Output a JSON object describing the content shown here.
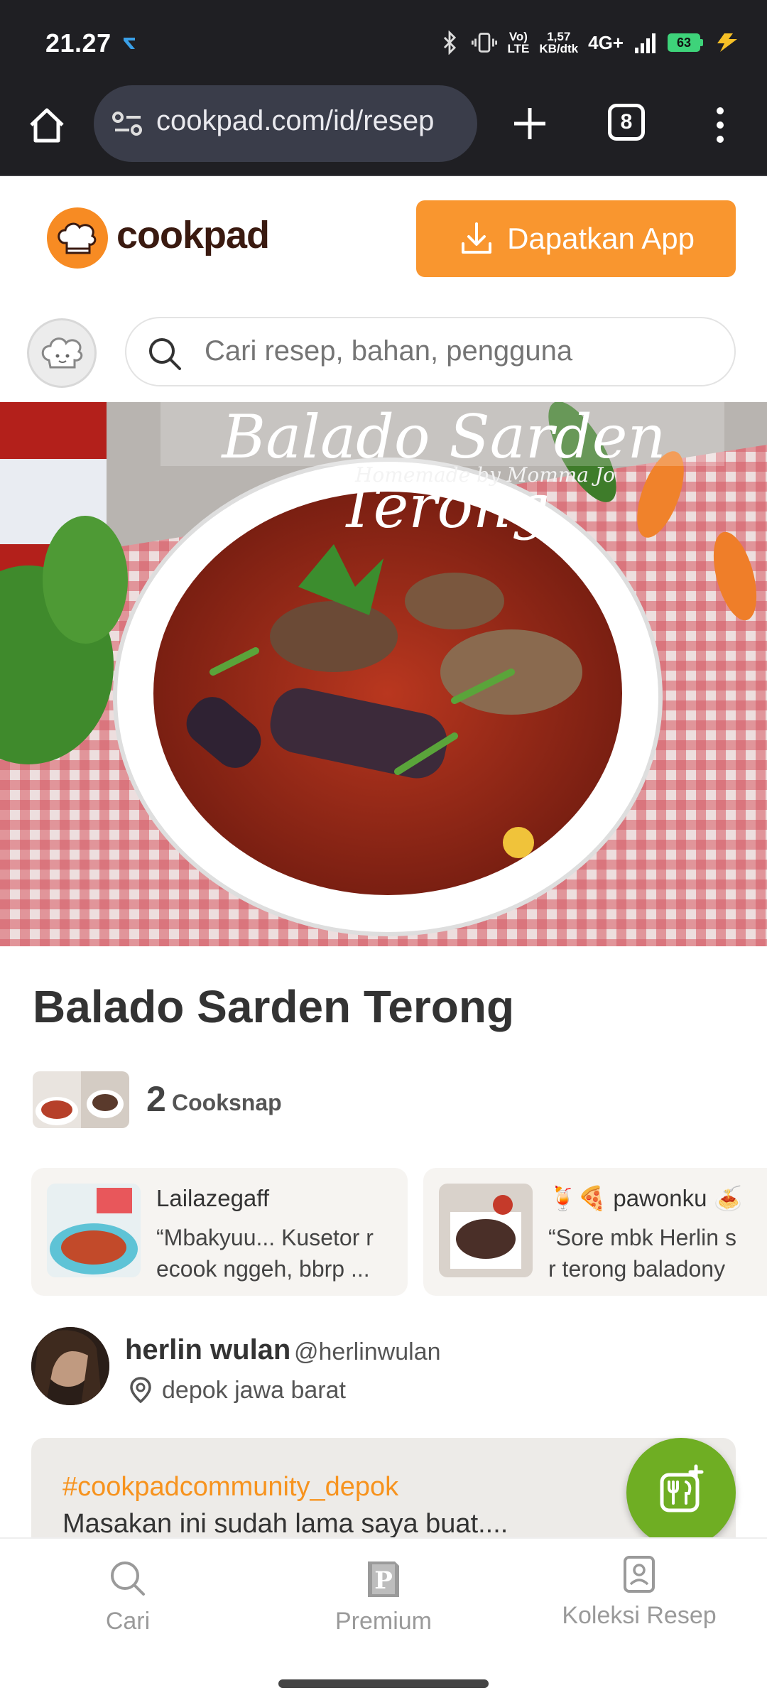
{
  "status_bar": {
    "time": "21.27",
    "net_speed_value": "1,57",
    "net_speed_unit": "KB/dtk",
    "volte_top": "Vo)",
    "volte_bottom": "LTE",
    "network": "4G+",
    "battery": "63"
  },
  "browser": {
    "url": "cookpad.com/id/resep",
    "tab_count": "8"
  },
  "header": {
    "logo_text": "cookpad",
    "get_app_label": "Dapatkan App"
  },
  "search": {
    "placeholder": "Cari resep, bahan, pengguna"
  },
  "hero": {
    "overlay_title": "Balado Sarden Terong",
    "overlay_subtitle": "Homemade by Momma Jo"
  },
  "recipe": {
    "title": "Balado Sarden Terong",
    "cooksnap_count": "2",
    "cooksnap_label": "Cooksnap"
  },
  "cooksnaps": [
    {
      "name": "Lailazegaff",
      "text": "“Mbakyuu... Kusetor r\necook nggeh, bbrp ..."
    },
    {
      "name": "🍹🍕 pawonku 🍝",
      "text": "“Sore mbk Herlin s\nr terong baladony"
    }
  ],
  "author": {
    "name": "herlin wulan",
    "handle": "@herlinwulan",
    "location": "depok jawa barat"
  },
  "description": {
    "hashtag": "#cookpadcommunity_depok",
    "text": "Masakan ini sudah lama saya buat...."
  },
  "bottom_nav": [
    {
      "label": "Cari",
      "icon": "search-icon"
    },
    {
      "label": "Premium",
      "icon": "premium-icon"
    },
    {
      "label": "Koleksi Resep",
      "icon": "collection-icon"
    }
  ],
  "colors": {
    "brand_orange": "#f9962f",
    "fab_green": "#6fae23",
    "hashtag_orange": "#f7931e"
  }
}
